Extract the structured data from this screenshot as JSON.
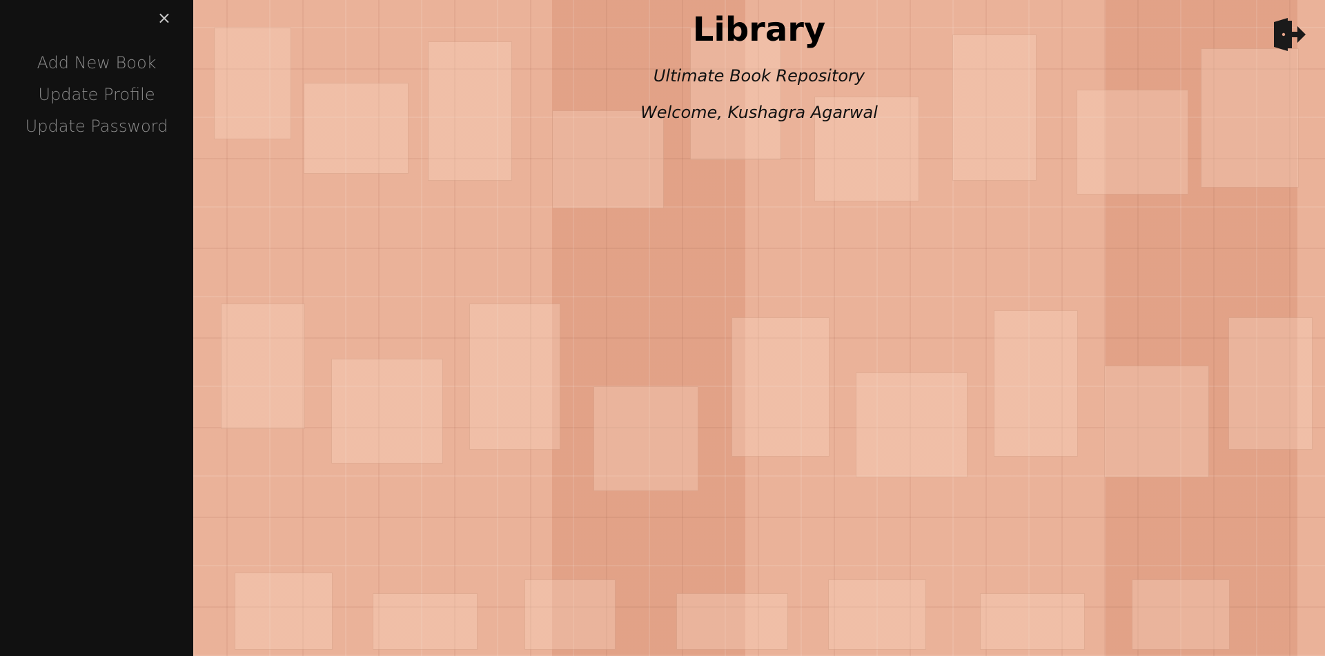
{
  "sidebar": {
    "close_label": "×",
    "items": [
      {
        "label": "Add New Book"
      },
      {
        "label": "Update Profile"
      },
      {
        "label": "Update Password"
      }
    ]
  },
  "header": {
    "title": "Library",
    "subtitle": "Ultimate Book Repository",
    "welcome": "Welcome, Kushagra Agarwal"
  },
  "icons": {
    "close": "close-icon",
    "logout": "logout-icon"
  },
  "colors": {
    "sidebar_bg": "#111111",
    "sidebar_text": "#8c8c8c",
    "main_bg": "#e6a58a",
    "title": "#000000"
  }
}
